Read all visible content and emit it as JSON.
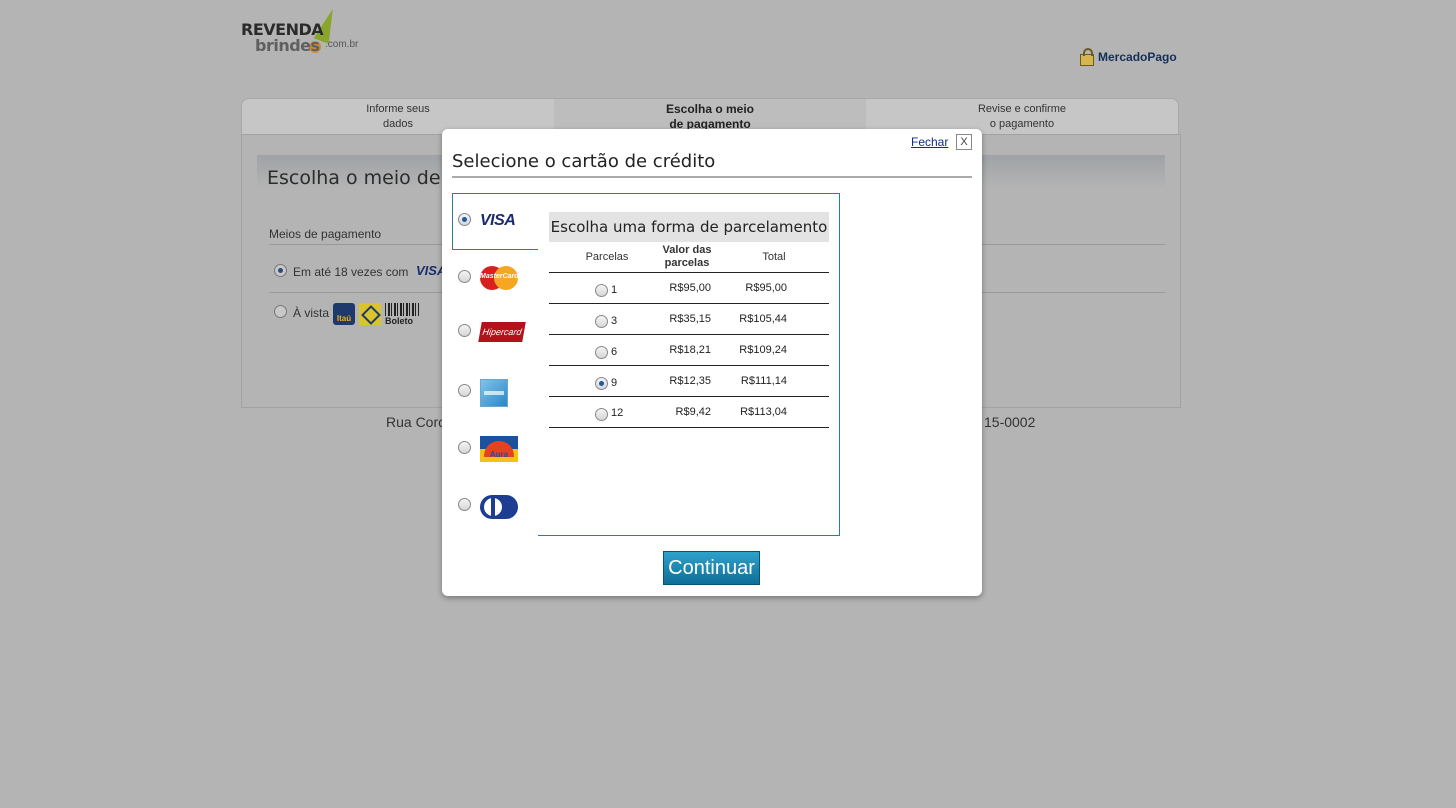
{
  "brand": {
    "line1": "REVENDA",
    "line2": "brindes",
    "suffix": ".com.br"
  },
  "mercadopago": {
    "label": "MercadoPago"
  },
  "steps": [
    {
      "line1": "Informe seus",
      "line2": "dados"
    },
    {
      "line1": "Escolha o meio",
      "line2": "de pagamento"
    },
    {
      "line1": "Revise e confirme",
      "line2": "o pagamento"
    }
  ],
  "page": {
    "title": "Escolha o meio de p",
    "section_label": "Meios de pagamento",
    "option_card": "Em até 18 vezes com",
    "option_card_brand": "VISA",
    "option_cash": "À vista",
    "bank_itau": "Itaú",
    "bank_boleto": "Boleto",
    "address_left": "Rua Corc",
    "address_right": "15-0002"
  },
  "modal": {
    "close_link": "Fechar",
    "close_x": "X",
    "title": "Selecione o cartão de crédito",
    "cards": [
      {
        "name": "visa-icon",
        "label": "VISA",
        "selected": true
      },
      {
        "name": "mastercard-icon",
        "label": "MasterCard",
        "selected": false
      },
      {
        "name": "hipercard-icon",
        "label": "Hipercard",
        "selected": false
      },
      {
        "name": "amex-icon",
        "label": "",
        "selected": false
      },
      {
        "name": "aura-icon",
        "label": "Aura",
        "selected": false
      },
      {
        "name": "diners-icon",
        "label": "",
        "selected": false
      }
    ],
    "installments": {
      "heading": "Escolha uma forma de parcelamento",
      "col_parcelas": "Parcelas",
      "col_valor_1": "Valor das",
      "col_valor_2": "parcelas",
      "col_total": "Total",
      "rows": [
        {
          "n": "1",
          "valor": "R$95,00",
          "total": "R$95,00",
          "selected": false
        },
        {
          "n": "3",
          "valor": "R$35,15",
          "total": "R$105,44",
          "selected": false
        },
        {
          "n": "6",
          "valor": "R$18,21",
          "total": "R$109,24",
          "selected": false
        },
        {
          "n": "9",
          "valor": "R$12,35",
          "total": "R$111,14",
          "selected": true
        },
        {
          "n": "12",
          "valor": "R$9,42",
          "total": "R$113,04",
          "selected": false
        }
      ]
    },
    "continue_label": "Continuar"
  }
}
